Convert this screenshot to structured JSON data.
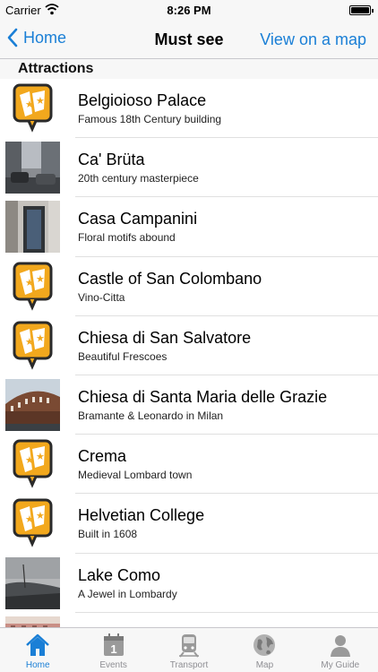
{
  "status_bar": {
    "carrier": "Carrier",
    "time": "8:26 PM"
  },
  "nav_bar": {
    "back_label": "Home",
    "title": "Must see",
    "map_link": "View on a map"
  },
  "section": {
    "header": "Attractions"
  },
  "items": [
    {
      "name": "Belgioioso Palace",
      "description": "Famous 18th Century building",
      "thumb": "badge-icon"
    },
    {
      "name": "Ca' Brüta",
      "description": "20th century masterpiece",
      "thumb": "street-photo"
    },
    {
      "name": "Casa Campanini",
      "description": "Floral motifs abound",
      "thumb": "doorway-photo"
    },
    {
      "name": "Castle of San Colombano",
      "description": "Vino-Citta",
      "thumb": "badge-icon"
    },
    {
      "name": "Chiesa di San Salvatore",
      "description": "Beautiful Frescoes",
      "thumb": "badge-icon"
    },
    {
      "name": "Chiesa di Santa Maria delle Grazie",
      "description": "Bramante & Leonardo in Milan",
      "thumb": "church-photo"
    },
    {
      "name": "Crema",
      "description": "Medieval Lombard town",
      "thumb": "badge-icon"
    },
    {
      "name": "Helvetian College",
      "description": "Built in 1608",
      "thumb": "badge-icon"
    },
    {
      "name": "Lake Como",
      "description": "A Jewel in Lombardy",
      "thumb": "lake-photo"
    },
    {
      "name": "",
      "description": "",
      "thumb": "building-photo"
    }
  ],
  "tab_bar": {
    "tabs": [
      {
        "label": "Home",
        "icon": "home-icon",
        "active": true
      },
      {
        "label": "Events",
        "icon": "calendar-icon",
        "active": false
      },
      {
        "label": "Transport",
        "icon": "train-icon",
        "active": false
      },
      {
        "label": "Map",
        "icon": "globe-icon",
        "active": false
      },
      {
        "label": "My Guide",
        "icon": "person-icon",
        "active": false
      }
    ]
  },
  "colors": {
    "accent": "#1a7fd6",
    "badge": "#f2a81d",
    "bar": "#f7f7f7"
  }
}
